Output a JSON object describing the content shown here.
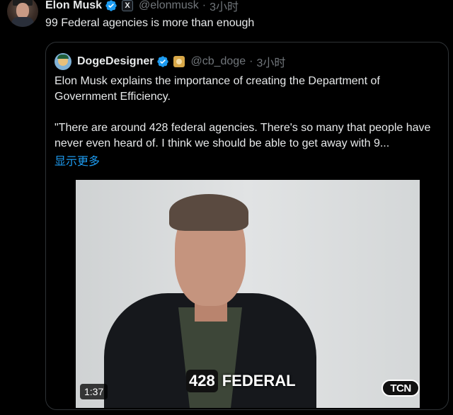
{
  "post": {
    "author_name": "Elon Musk",
    "author_handle": "@elonmusk",
    "separator": "·",
    "time": "3小时",
    "badge_icon": "x-logo-icon",
    "text": "99 Federal agencies is more than enough"
  },
  "quote": {
    "author_name": "DogeDesigner",
    "author_handle": "@cb_doge",
    "separator": "·",
    "time": "3小时",
    "paragraph1": "Elon Musk explains the importance of creating the Department of Government Efficiency.",
    "paragraph2": "\"There are around 428 federal agencies. There's so many that people have never even heard of. I think we should be able to get away with 9...",
    "show_more": "显示更多",
    "video": {
      "caption_number": "428",
      "caption_word": "FEDERAL",
      "duration": "1:37",
      "watermark": "TCN"
    }
  },
  "colors": {
    "background": "#000000",
    "text": "#e7e9ea",
    "secondary": "#71767b",
    "link": "#1d9bf0",
    "verified": "#1d9bf0",
    "border": "#2f3336"
  }
}
